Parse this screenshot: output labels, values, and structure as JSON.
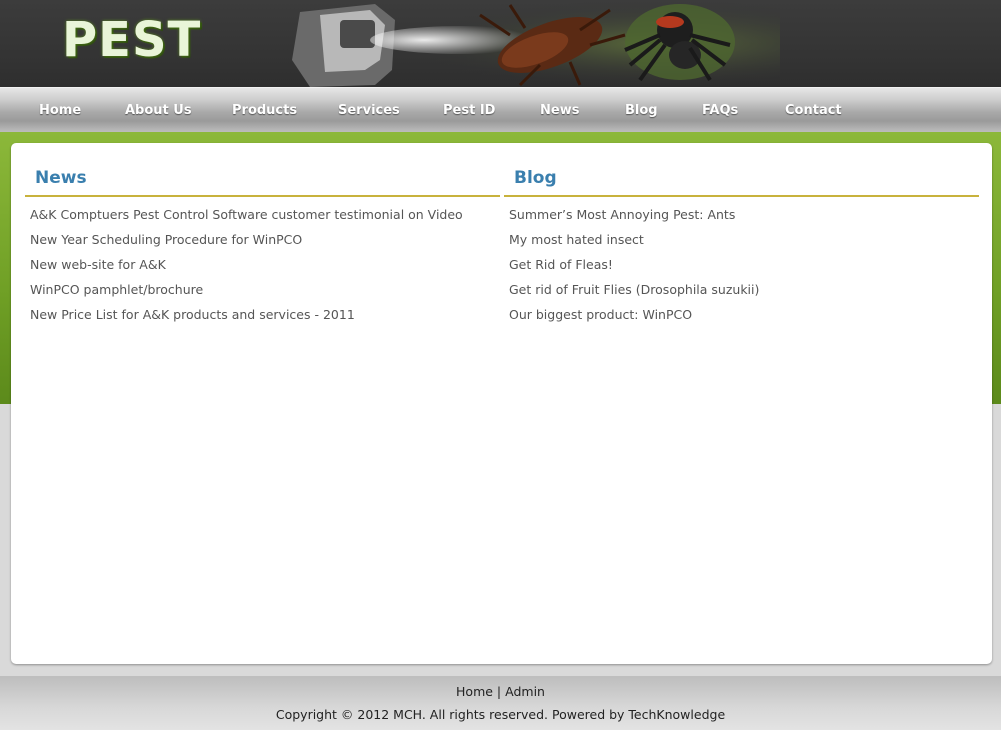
{
  "header": {
    "logo": "PEST"
  },
  "nav": {
    "items": [
      "Home",
      "About Us",
      "Products",
      "Services",
      "Pest ID",
      "News",
      "Blog",
      "FAQs",
      "Contact"
    ]
  },
  "news": {
    "title": "News",
    "items": [
      "A&K Comptuers Pest Control Software customer testimonial on Video",
      "New Year Scheduling Procedure for WinPCO",
      "New web-site for A&K",
      "WinPCO pamphlet/brochure",
      "New Price List for A&K products and services - 2011"
    ]
  },
  "blog": {
    "title": "Blog",
    "items": [
      "Summer’s Most Annoying Pest: Ants",
      "My most hated insect",
      "Get Rid of Fleas!",
      "Get rid of Fruit Flies (Drosophila suzukii)",
      "Our biggest product: WinPCO"
    ]
  },
  "footer": {
    "home_link": "Home",
    "separator": "|",
    "admin_link": "Admin",
    "copyright": "Copyright © 2012 MCH. All rights reserved. Powered by TechKnowledge"
  },
  "colors": {
    "accent_green": "#7aa82c",
    "heading_blue": "#3a7fae",
    "rule_gold": "#c8b23c"
  }
}
